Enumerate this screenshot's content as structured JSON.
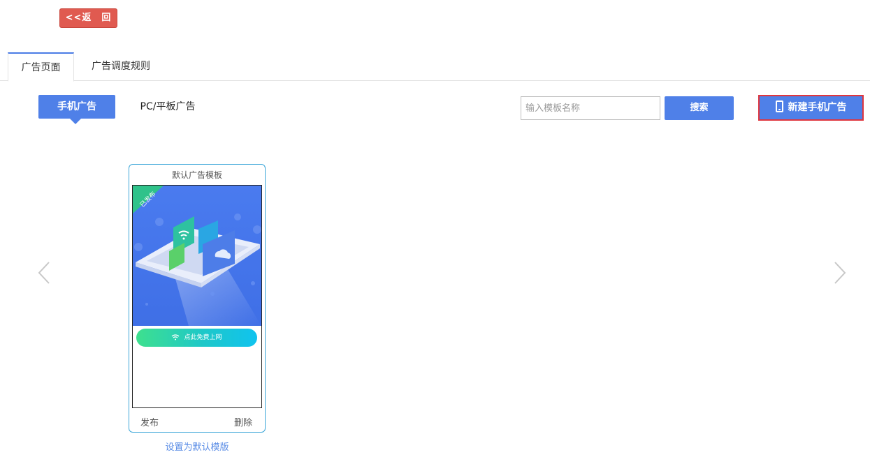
{
  "back_button": {
    "label": "<<返　回"
  },
  "tabs": [
    {
      "label": "广告页面",
      "active": true
    },
    {
      "label": "广告调度规则",
      "active": false
    }
  ],
  "segment": {
    "active_label": "手机广告",
    "other_label": "PC/平板广告"
  },
  "search": {
    "placeholder": "输入模板名称",
    "value": "",
    "button_label": "搜索"
  },
  "new_ad_button": {
    "label": "新建手机广告",
    "icon": "mobile-phone-icon"
  },
  "templates": [
    {
      "title": "默认广告模板",
      "ribbon": "已发布",
      "cta_label": "点此免费上网",
      "actions": {
        "publish": "发布",
        "delete": "删除"
      },
      "set_default_label": "设置为默认模版"
    }
  ],
  "colors": {
    "primary": "#4f80e8",
    "back_button": "#e05a50",
    "highlight_border": "#e0353d",
    "card_border": "#3ba6d8",
    "ribbon": "#2fc28a",
    "link": "#5b8de6"
  },
  "icons": {
    "prev": "chevron-left-icon",
    "next": "chevron-right-icon"
  }
}
